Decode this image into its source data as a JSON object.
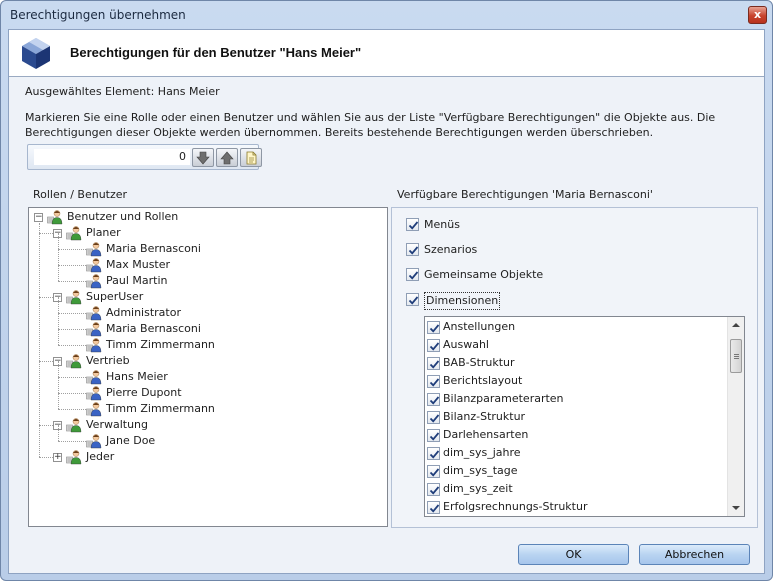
{
  "window": {
    "title": "Berechtigungen übernehmen",
    "close_glyph": "x"
  },
  "header": {
    "title": "Berechtigungen für den Benutzer \"Hans Meier\"",
    "logo_icon": "cube-logo-icon"
  },
  "selected_element": "Ausgewähltes Element: Hans Meier",
  "instructions": "Markieren Sie eine Rolle oder einen Benutzer und wählen Sie aus der Liste \"Verfügbare Berechtigungen\" die Objekte aus. Die Berechtigungen dieser Objekte werden übernommen. Bereits bestehende Berechtigungen werden überschrieben.",
  "toolbar": {
    "count": "0",
    "buttons": [
      {
        "name": "move-down-button",
        "icon": "arrow-down-icon"
      },
      {
        "name": "move-up-button",
        "icon": "arrow-up-icon"
      },
      {
        "name": "document-button",
        "icon": "document-icon"
      }
    ]
  },
  "roles_label": "Rollen / Benutzer",
  "tree": [
    {
      "label": "Benutzer und Rollen",
      "level": 0,
      "expander": "-",
      "type": "root"
    },
    {
      "label": "Planer",
      "level": 1,
      "expander": "-",
      "type": "role"
    },
    {
      "label": "Maria Bernasconi",
      "level": 2,
      "type": "user"
    },
    {
      "label": "Max Muster",
      "level": 2,
      "type": "user"
    },
    {
      "label": "Paul Martin",
      "level": 2,
      "type": "user"
    },
    {
      "label": "SuperUser",
      "level": 1,
      "expander": "-",
      "type": "role"
    },
    {
      "label": "Administrator",
      "level": 2,
      "type": "user"
    },
    {
      "label": "Maria Bernasconi",
      "level": 2,
      "type": "user"
    },
    {
      "label": "Timm Zimmermann",
      "level": 2,
      "type": "user"
    },
    {
      "label": "Vertrieb",
      "level": 1,
      "expander": "-",
      "type": "role"
    },
    {
      "label": "Hans Meier",
      "level": 2,
      "type": "user"
    },
    {
      "label": "Pierre Dupont",
      "level": 2,
      "type": "user"
    },
    {
      "label": "Timm Zimmermann",
      "level": 2,
      "type": "user"
    },
    {
      "label": "Verwaltung",
      "level": 1,
      "expander": "-",
      "type": "role"
    },
    {
      "label": "Jane Doe",
      "level": 2,
      "type": "user"
    },
    {
      "label": "Jeder",
      "level": 1,
      "expander": "+",
      "type": "role"
    }
  ],
  "perms_label": "Verfügbare Berechtigungen 'Maria Bernasconi'",
  "permissions": [
    {
      "label": "Menüs",
      "checked": true
    },
    {
      "label": "Szenarios",
      "checked": true
    },
    {
      "label": "Gemeinsame Objekte",
      "checked": true
    },
    {
      "label": "Dimensionen",
      "checked": true,
      "focused": true
    }
  ],
  "dimensions": [
    {
      "label": "Anstellungen",
      "checked": true
    },
    {
      "label": "Auswahl",
      "checked": true
    },
    {
      "label": "BAB-Struktur",
      "checked": true
    },
    {
      "label": "Berichtslayout",
      "checked": true
    },
    {
      "label": "Bilanzparameterarten",
      "checked": true
    },
    {
      "label": "Bilanz-Struktur",
      "checked": true
    },
    {
      "label": "Darlehensarten",
      "checked": true
    },
    {
      "label": "dim_sys_jahre",
      "checked": true
    },
    {
      "label": "dim_sys_tage",
      "checked": true
    },
    {
      "label": "dim_sys_zeit",
      "checked": true
    },
    {
      "label": "Erfolgsrechnungs-Struktur",
      "checked": true
    }
  ],
  "dimensions_scroll_fraction": 0.04,
  "buttons": {
    "ok": "OK",
    "cancel": "Abbrechen"
  },
  "colors": {
    "accent": "#2b4a8f",
    "button": "#b9d4f1",
    "client_bg": "#eef2f8"
  }
}
